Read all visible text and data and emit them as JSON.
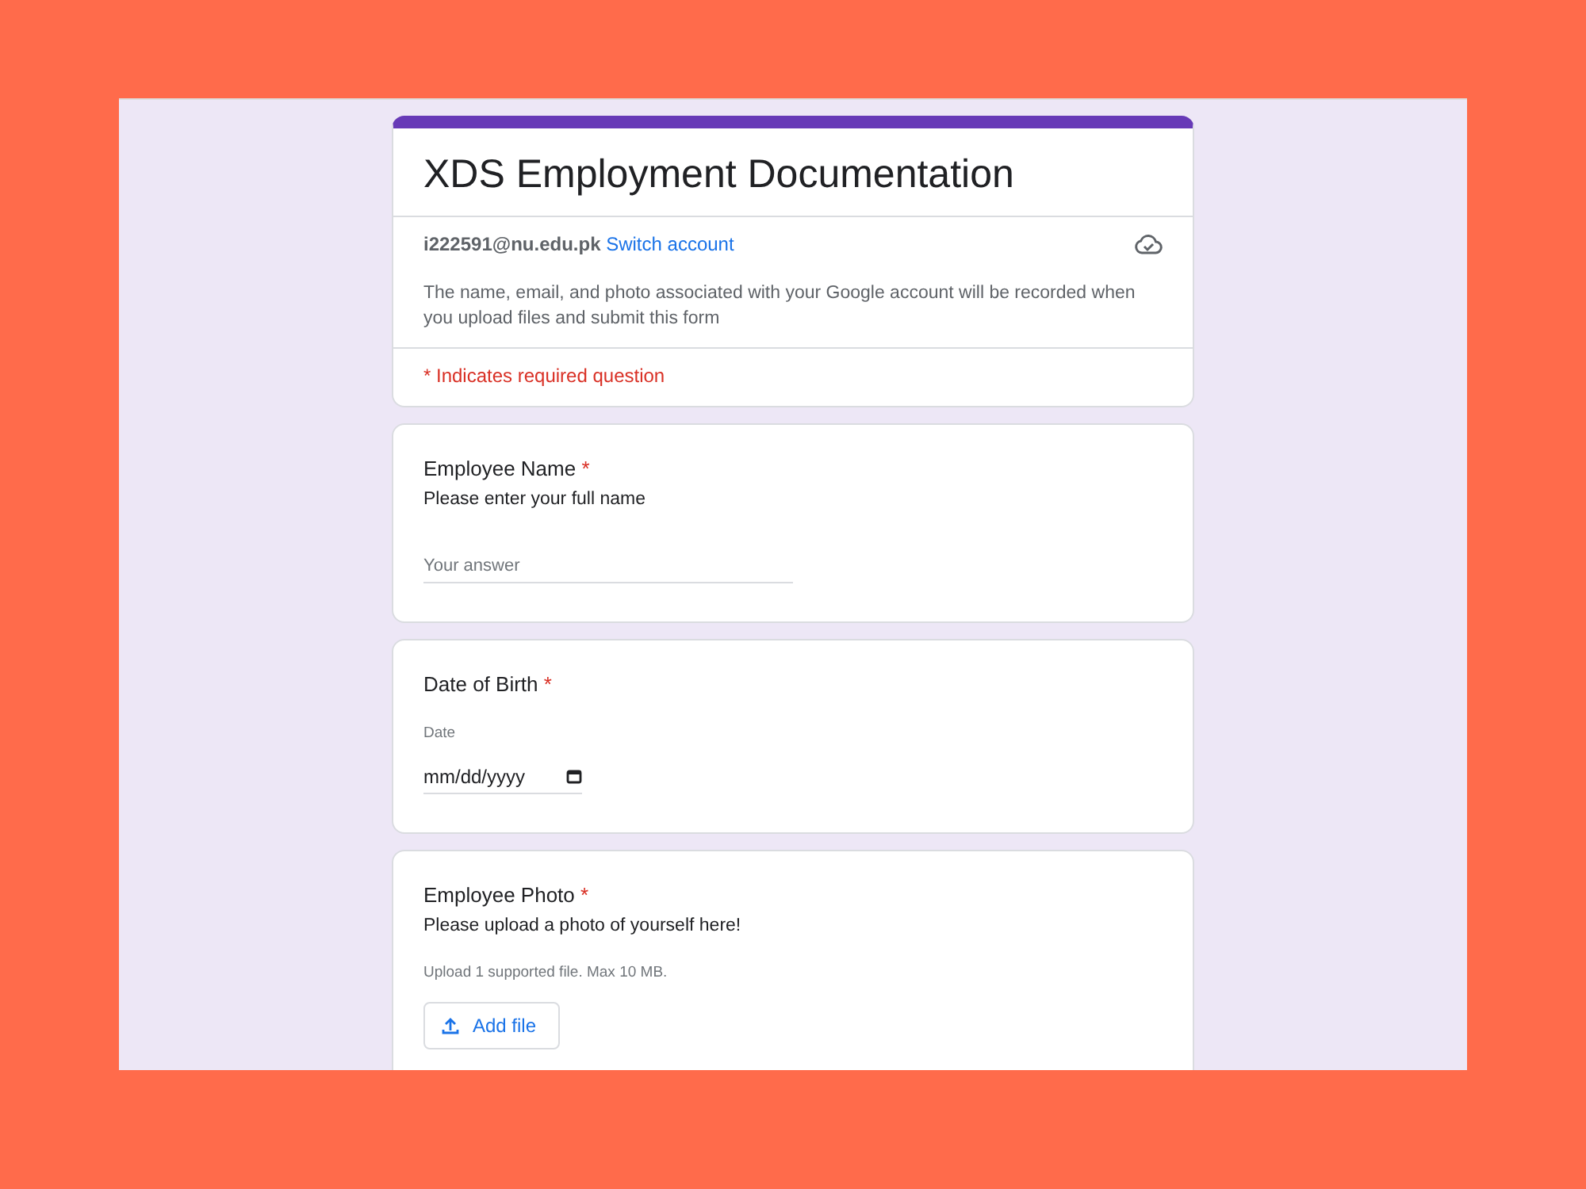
{
  "form": {
    "title": "XDS Employment Documentation",
    "account": {
      "email": "i222591@nu.edu.pk",
      "switch_link": "Switch account"
    },
    "notice": "The name, email, and photo associated with your Google account will be recorded when you upload files and submit this form",
    "required_note": "* Indicates required question"
  },
  "questions": [
    {
      "kind": "text",
      "title": "Employee Name",
      "required_mark": "*",
      "description": "Please enter your full name",
      "placeholder": "Your answer"
    },
    {
      "kind": "date",
      "title": "Date of Birth",
      "required_mark": "*",
      "field_label": "Date",
      "placeholder": "mm/dd/yyyy"
    },
    {
      "kind": "file",
      "title": "Employee Photo",
      "required_mark": "*",
      "description": "Please upload a photo of yourself here!",
      "hint": "Upload 1 supported file. Max 10 MB.",
      "button": "Add file"
    }
  ]
}
